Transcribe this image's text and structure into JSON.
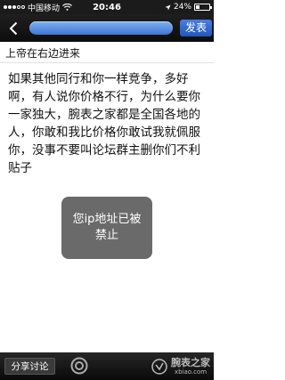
{
  "status": {
    "carrier": "中国移动",
    "time": "20:46",
    "battery": "24%"
  },
  "nav": {
    "publish_label": "发表"
  },
  "post": {
    "subject": "上帝在右边进来",
    "body": "如果其他同行和你一样竞争，多好啊，有人说你价格不行，为什么要你一家独大，腕表之家都是全国各地的人，你敢和我比价格你敢试我就佩服你，没事不要叫论坛群主删你们不利贴子"
  },
  "toast": {
    "message": "您ip地址已被禁止"
  },
  "bottom": {
    "share_label": "分享讨论",
    "watermark_cn": "腕表之家",
    "watermark_en": "xbiao.com"
  }
}
